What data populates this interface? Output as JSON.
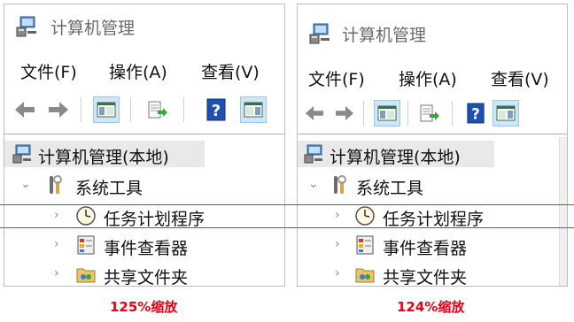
{
  "left": {
    "title": "计算机管理",
    "menu": [
      "文件(F)",
      "操作(A)",
      "查看(V)"
    ],
    "root": "计算机管理(本地)",
    "group": "系统工具",
    "items": [
      "任务计划程序",
      "事件查看器",
      "共享文件夹"
    ],
    "caption": "125%缩放"
  },
  "right": {
    "title": "计算机管理",
    "menu": [
      "文件(F)",
      "操作(A)",
      "查看(V)"
    ],
    "root": "计算机管理(本地)",
    "group": "系统工具",
    "items": [
      "任务计划程序",
      "事件查看器",
      "共享文件夹"
    ],
    "caption": "124%缩放"
  },
  "colors": {
    "caption": "#e60012",
    "guide_line": "#d32f2f",
    "toolbar_active": "#cfe6f8"
  },
  "icons": {
    "app": "computer-management-icon",
    "toolbar": [
      "back-arrow-icon",
      "forward-arrow-icon",
      "show-hide-console-tree-icon",
      "export-list-icon",
      "help-icon",
      "show-hide-action-pane-icon"
    ],
    "tree": [
      "computer-management-icon",
      "tools-icon",
      "clock-icon",
      "event-viewer-icon",
      "shared-folder-icon"
    ]
  }
}
